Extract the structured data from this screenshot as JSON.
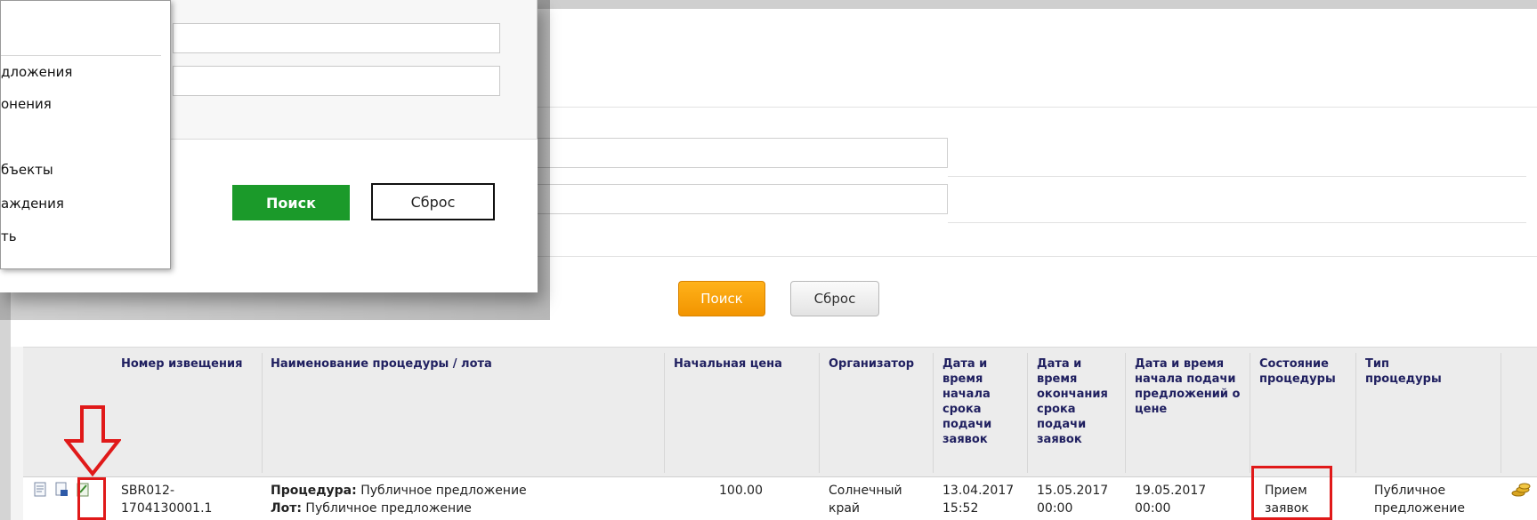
{
  "background_page": {
    "search_button": "Поиск",
    "reset_button": "Сброс"
  },
  "table": {
    "headers": [
      "Номер извещения",
      "Наименование процедуры / лота",
      "Начальная цена",
      "Организатор",
      "Дата и время начала срока подачи заявок",
      "Дата и время окончания срока подачи заявок",
      "Дата и время начала подачи предложений о цене",
      "Состояние процедуры",
      "Тип процедуры"
    ],
    "row": {
      "number": "SBR012-1704130001.1",
      "procedure_label": "Процедура:",
      "procedure_value": "Публичное предложение",
      "lot_label": "Лот:",
      "lot_value": "Публичное предложение",
      "price": "100.00",
      "organizer": "Солнечный край",
      "start_date": "13.04.2017 15:52",
      "end_date": "15.05.2017 00:00",
      "offers_date": "19.05.2017 00:00",
      "state": "Прием заявок",
      "type": "Публичное предложение"
    }
  },
  "popup": {
    "search_button": "Поиск",
    "reset_button": "Сброс",
    "menu_items": [
      "дложения",
      "онения",
      "бъекты",
      "аждения",
      "ть"
    ]
  },
  "colors": {
    "accent_orange": "#f29400",
    "accent_green": "#1b9a2a",
    "annotation_red": "#e01919",
    "header_text": "#202060"
  }
}
